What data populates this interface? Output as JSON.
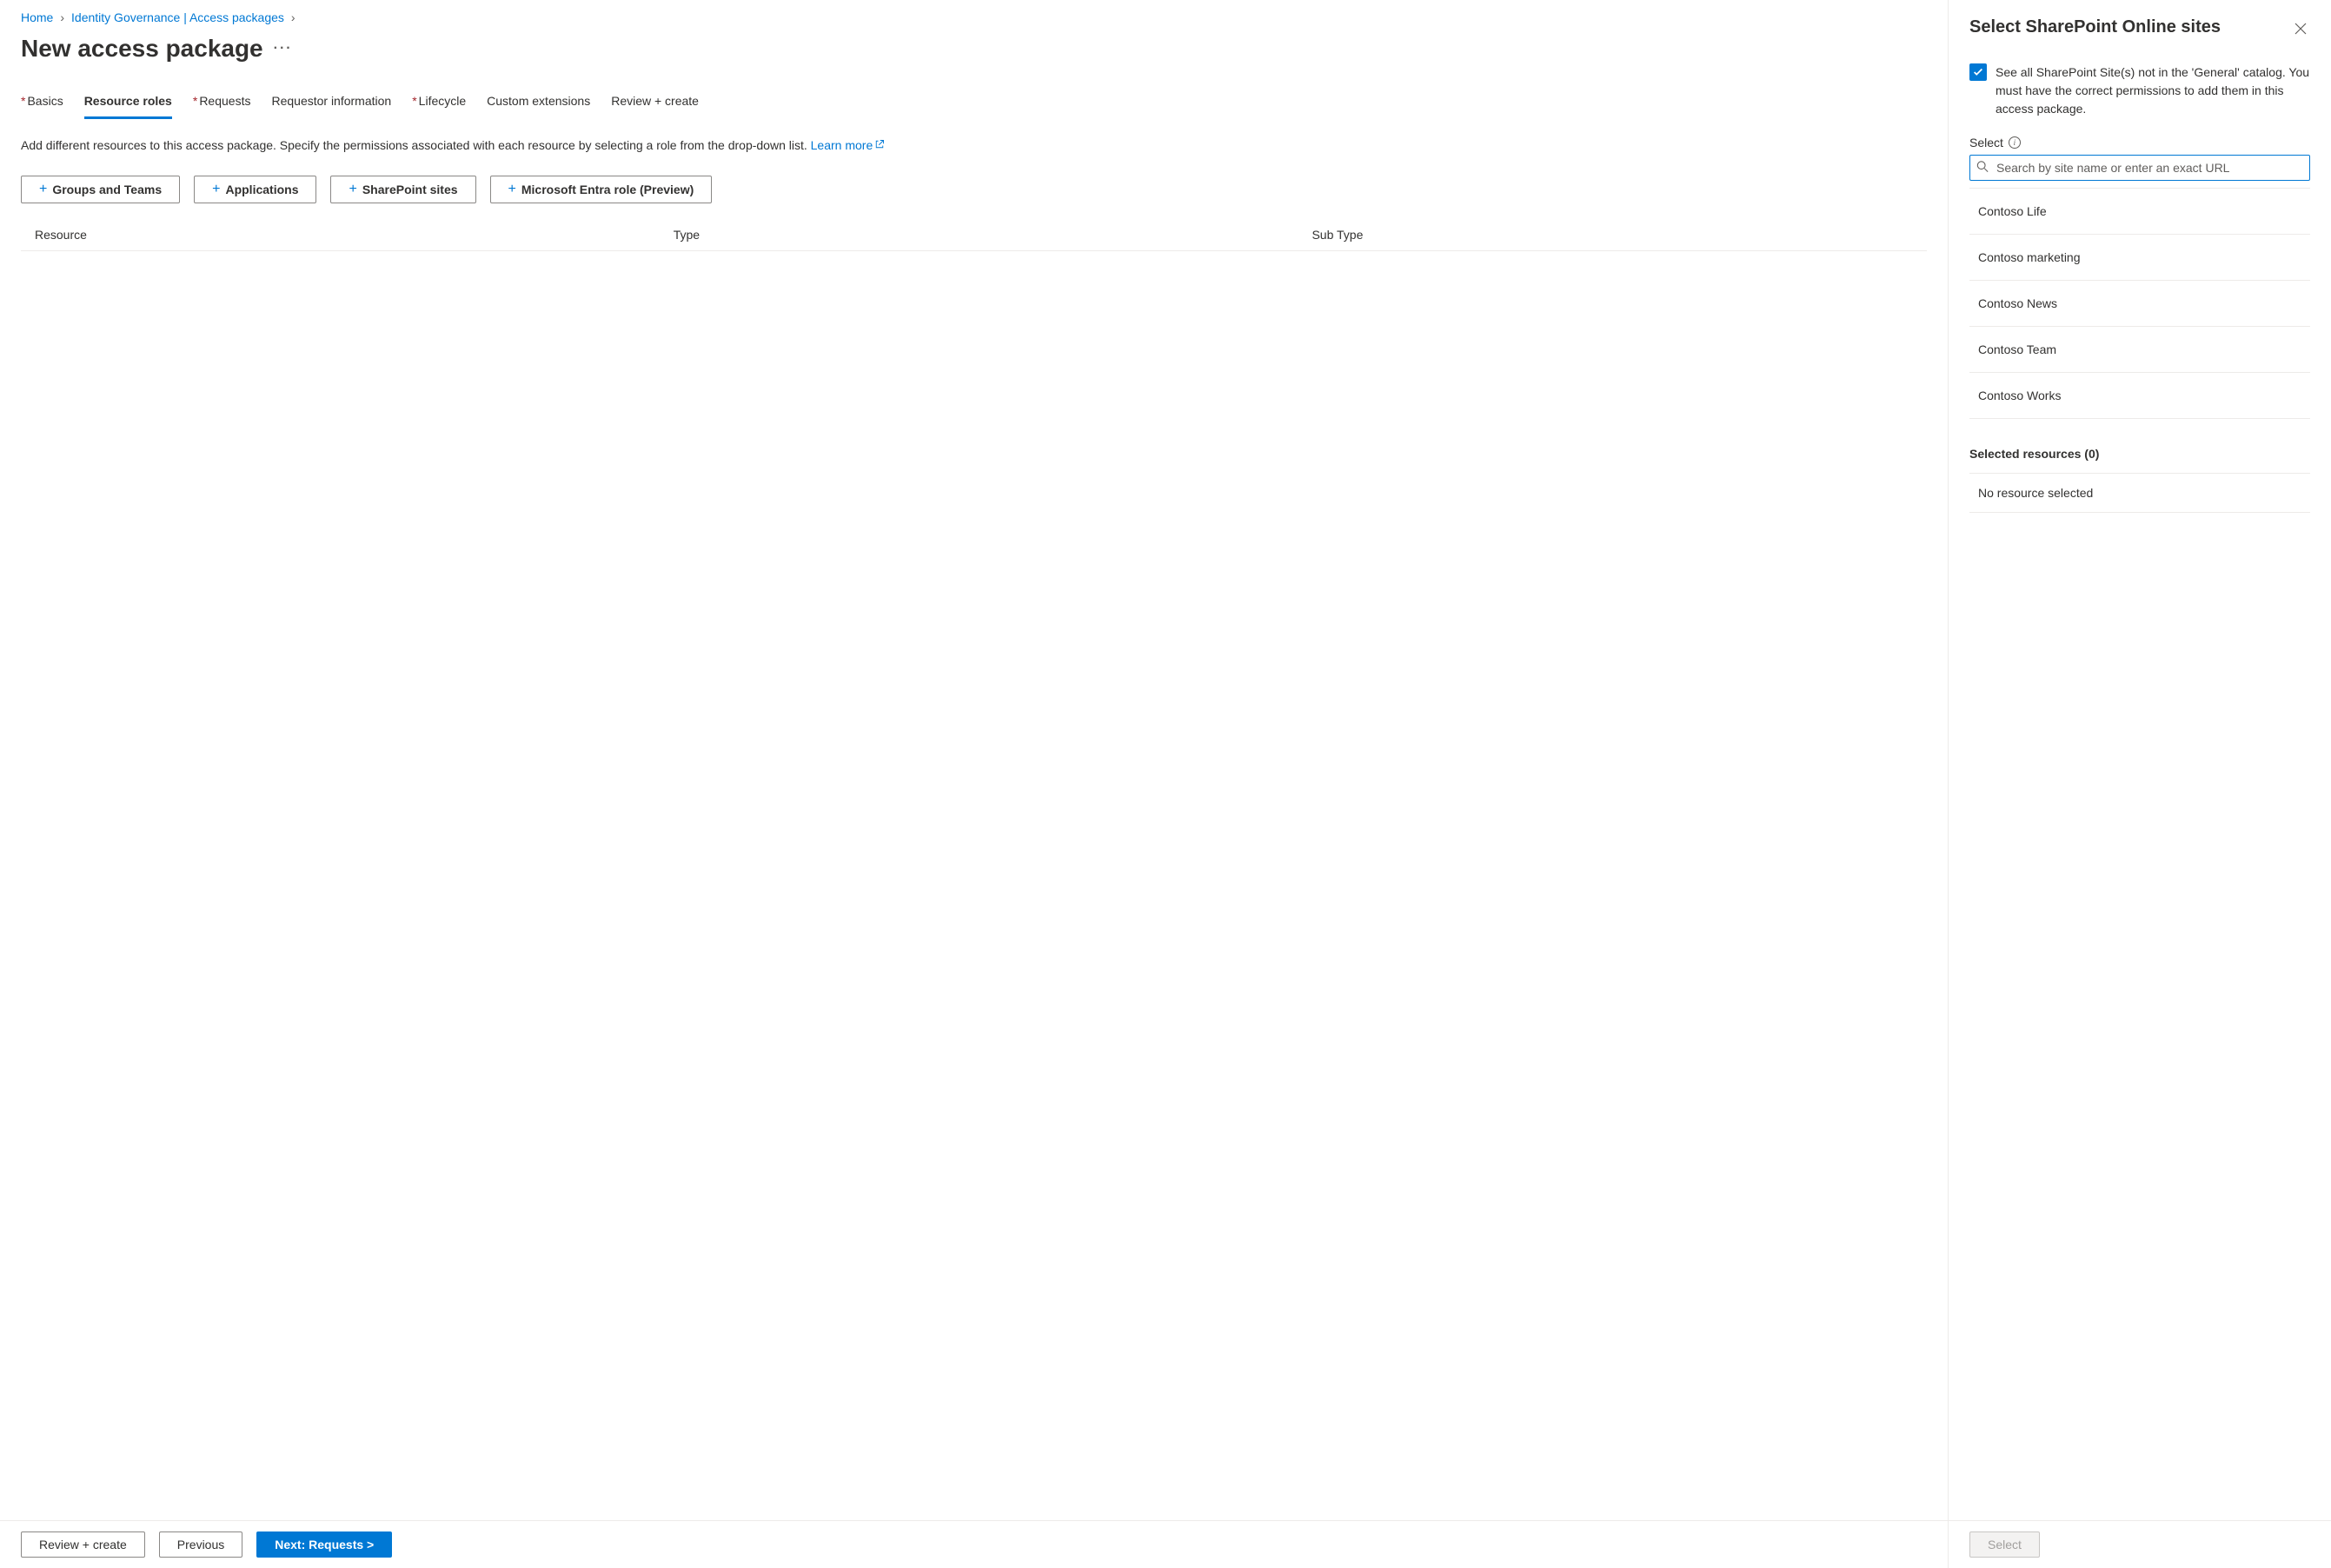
{
  "breadcrumb": {
    "home": "Home",
    "governance": "Identity Governance | Access packages"
  },
  "page_title": "New access package",
  "tabs": {
    "basics": "Basics",
    "resource_roles": "Resource roles",
    "requests": "Requests",
    "requestor_info": "Requestor information",
    "lifecycle": "Lifecycle",
    "custom_ext": "Custom extensions",
    "review_create": "Review + create"
  },
  "help_text": "Add different resources to this access package. Specify the permissions associated with each resource by selecting a role from the drop-down list. ",
  "learn_more": "Learn more",
  "resource_buttons": {
    "groups": "Groups and Teams",
    "apps": "Applications",
    "sharepoint": "SharePoint sites",
    "entra_role": "Microsoft Entra role (Preview)"
  },
  "columns": {
    "resource": "Resource",
    "type": "Type",
    "subtype": "Sub Type"
  },
  "footer": {
    "review": "Review + create",
    "previous": "Previous",
    "next": "Next: Requests >"
  },
  "panel": {
    "title": "Select SharePoint Online sites",
    "checkbox_text": "See all SharePoint Site(s) not in the 'General' catalog. You must have the correct permissions to add them in this access package.",
    "select_label": "Select",
    "search_placeholder": "Search by site name or enter an exact URL",
    "sites": [
      "Contoso Life",
      "Contoso marketing",
      "Contoso News",
      "Contoso Team",
      "Contoso Works"
    ],
    "selected_header": "Selected resources (0)",
    "no_selection": "No resource selected",
    "select_btn": "Select"
  }
}
